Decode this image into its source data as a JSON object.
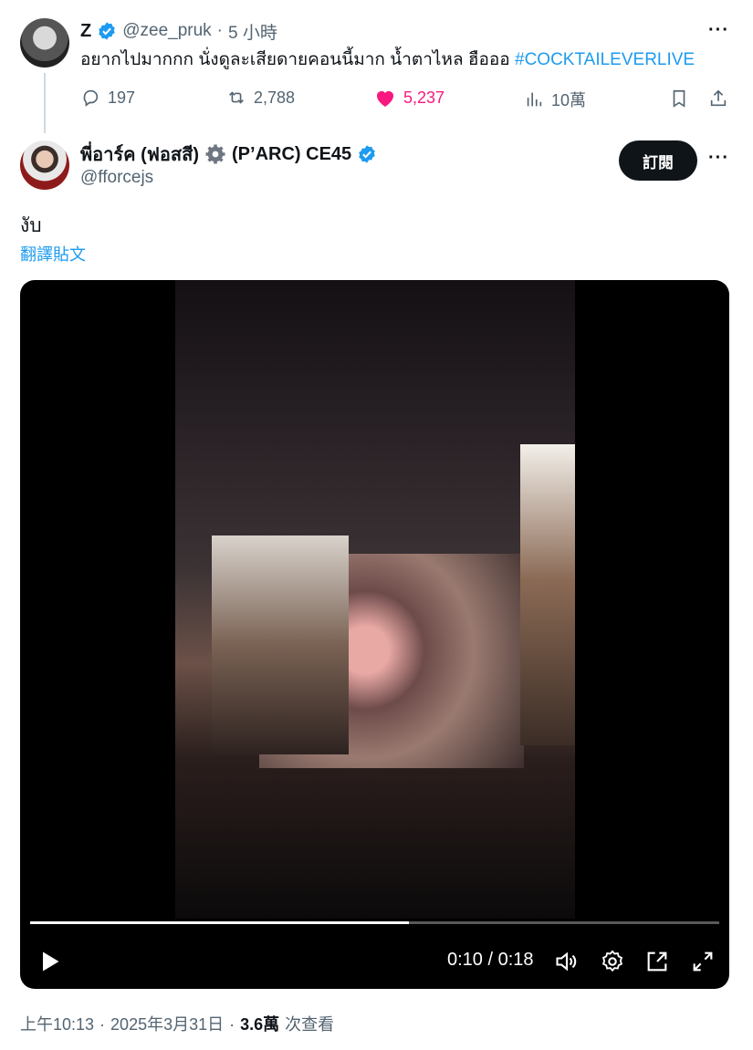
{
  "quoted_post": {
    "display_name": "Z",
    "handle": "@zee_pruk",
    "separator": "·",
    "time": "5 小時",
    "text": "อยากไปมากกก นั่งดูละเสียดายคอนนี้มาก น้ำตาไหล ฮือออ",
    "hashtag": "#COCKTAILEVERLIVE",
    "stats": {
      "replies": "197",
      "reposts": "2,788",
      "likes": "5,237",
      "views": "10萬"
    }
  },
  "main_post": {
    "display_name": "พี่อาร์ค (ฟอสสี) ⚙️ (P’ARC) CE45",
    "display_name_parts": {
      "before": "พี่อาร์ค (ฟอสสี)",
      "after": "(P’ARC) CE45"
    },
    "handle": "@fforcejs",
    "subscribe_label": "訂閱",
    "text": "งับ",
    "translate_label": "翻譯貼文",
    "video": {
      "time": "0:10 / 0:18",
      "progress": 0.55
    },
    "footer": {
      "time": "上午10:13",
      "date": "2025年3月31日",
      "views_count": "3.6萬",
      "views_label": "次查看",
      "separator": "·"
    }
  },
  "icons": [
    "verified-badge-icon",
    "reply-icon",
    "repost-icon",
    "like-icon",
    "views-icon",
    "bookmark-icon",
    "share-icon",
    "more-icon",
    "gear-icon",
    "play-icon",
    "volume-icon",
    "settings-icon",
    "pip-icon",
    "fullscreen-icon"
  ],
  "colors": {
    "accent": "#1d9bf0",
    "like": "#f91880",
    "text": "#0f1419",
    "muted": "#536471"
  }
}
